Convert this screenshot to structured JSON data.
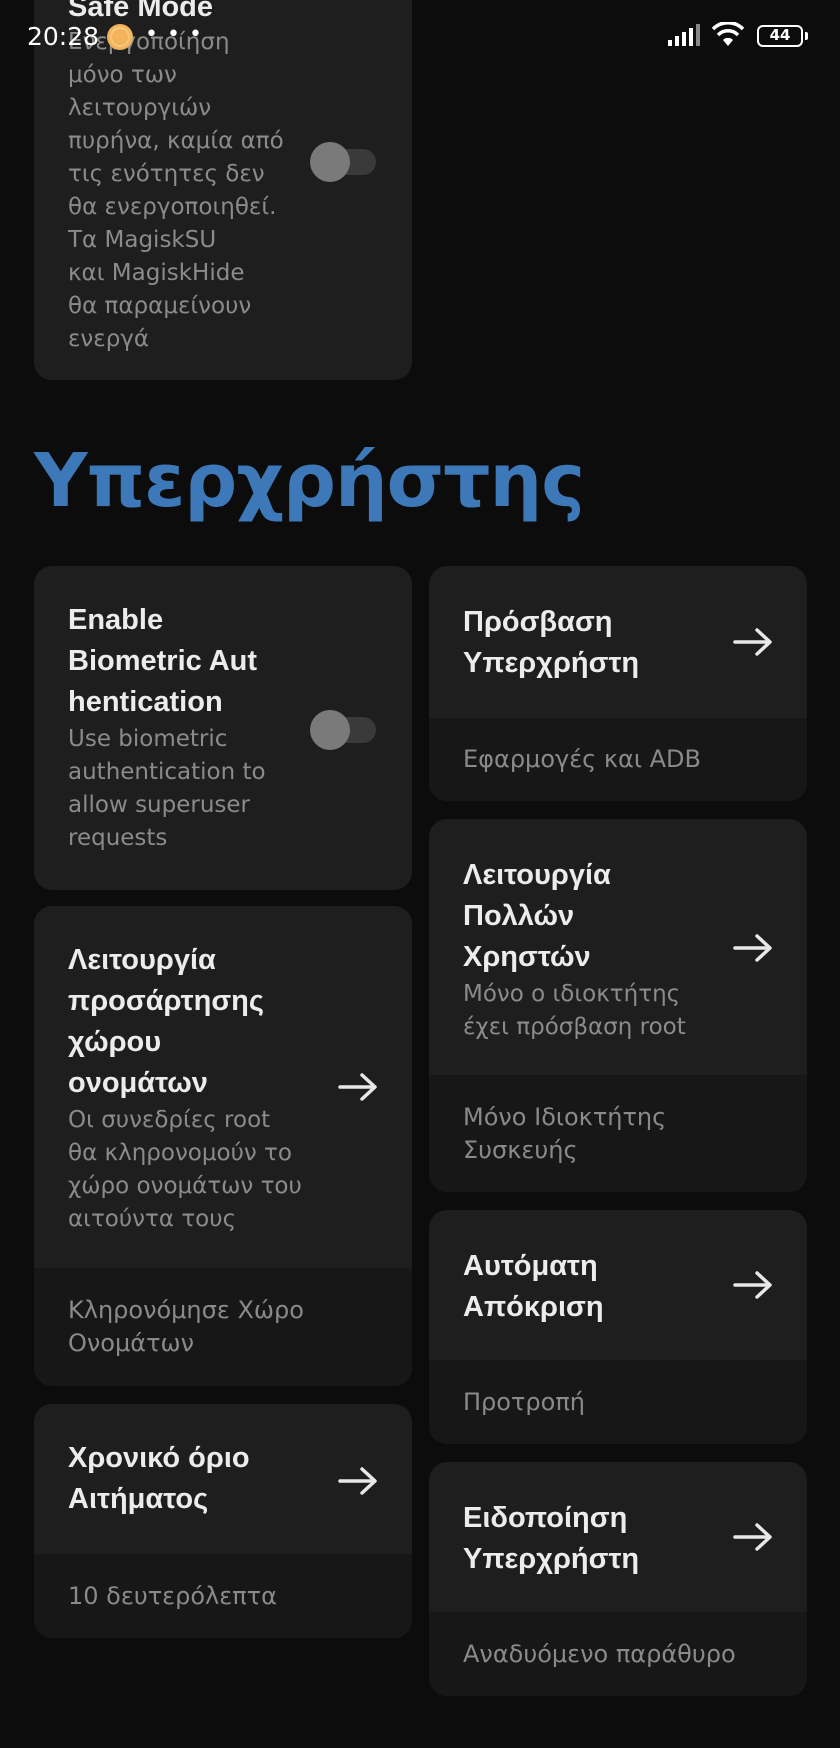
{
  "status_bar": {
    "time": "20:28",
    "more": "• • •",
    "battery": "44"
  },
  "safe_mode": {
    "title": "Safe Mode",
    "description_lines": [
      "Ενεργοποίηση",
      "μόνο των",
      "λειτουργιών",
      "πυρήνα, καμία από",
      "τις ενότητες δεν",
      "θα ενεργοποιηθεί.",
      "Τα MagiskSU",
      "και MagiskHide",
      "θα παραμείνουν",
      "ενεργά"
    ],
    "enabled": false
  },
  "section": {
    "title": "Υπερχρήστης"
  },
  "biometric": {
    "title_lines": [
      "Enable",
      "Biometric Aut",
      "hentication"
    ],
    "description_lines": [
      "Use biometric",
      "authentication to",
      "allow superuser",
      "requests"
    ],
    "enabled": false
  },
  "superuser_access": {
    "title_lines": [
      "Πρόσβαση",
      "Υπερχρήστη"
    ],
    "value": "Εφαρμογές και ADB"
  },
  "multiuser": {
    "title_lines": [
      "Λειτουργία",
      "Πολλών",
      "Χρηστών"
    ],
    "description_lines": [
      "Μόνο ο ιδιοκτήτης",
      "έχει πρόσβαση root"
    ],
    "value_lines": [
      "Μόνο Ιδιοκτήτης",
      "Συσκευής"
    ]
  },
  "namespace": {
    "title_lines": [
      "Λειτουργία",
      "προσάρτησης",
      "χώρου",
      "ονομάτων"
    ],
    "description_lines": [
      "Οι συνεδρίες root",
      "θα κληρονομούν το",
      "χώρο ονομάτων του",
      "αιτούντα τους"
    ],
    "value_lines": [
      "Κληρονόμησε Χώρο",
      "Ονομάτων"
    ]
  },
  "auto_response": {
    "title_lines": [
      "Αυτόματη",
      "Απόκριση"
    ],
    "value": "Προτροπή"
  },
  "request_timeout": {
    "title_lines": [
      "Χρονικό όριο",
      "Αιτήματος"
    ],
    "value": "10 δευτερόλεπτα"
  },
  "notification": {
    "title_lines": [
      "Ειδοποίηση",
      "Υπερχρήστη"
    ],
    "value": "Αναδυόμενο παράθυρο"
  },
  "colors": {
    "background": "#0c0c0c",
    "card": "#1e1e1e",
    "card_footer": "#171717",
    "accent": "#3d78b8"
  }
}
